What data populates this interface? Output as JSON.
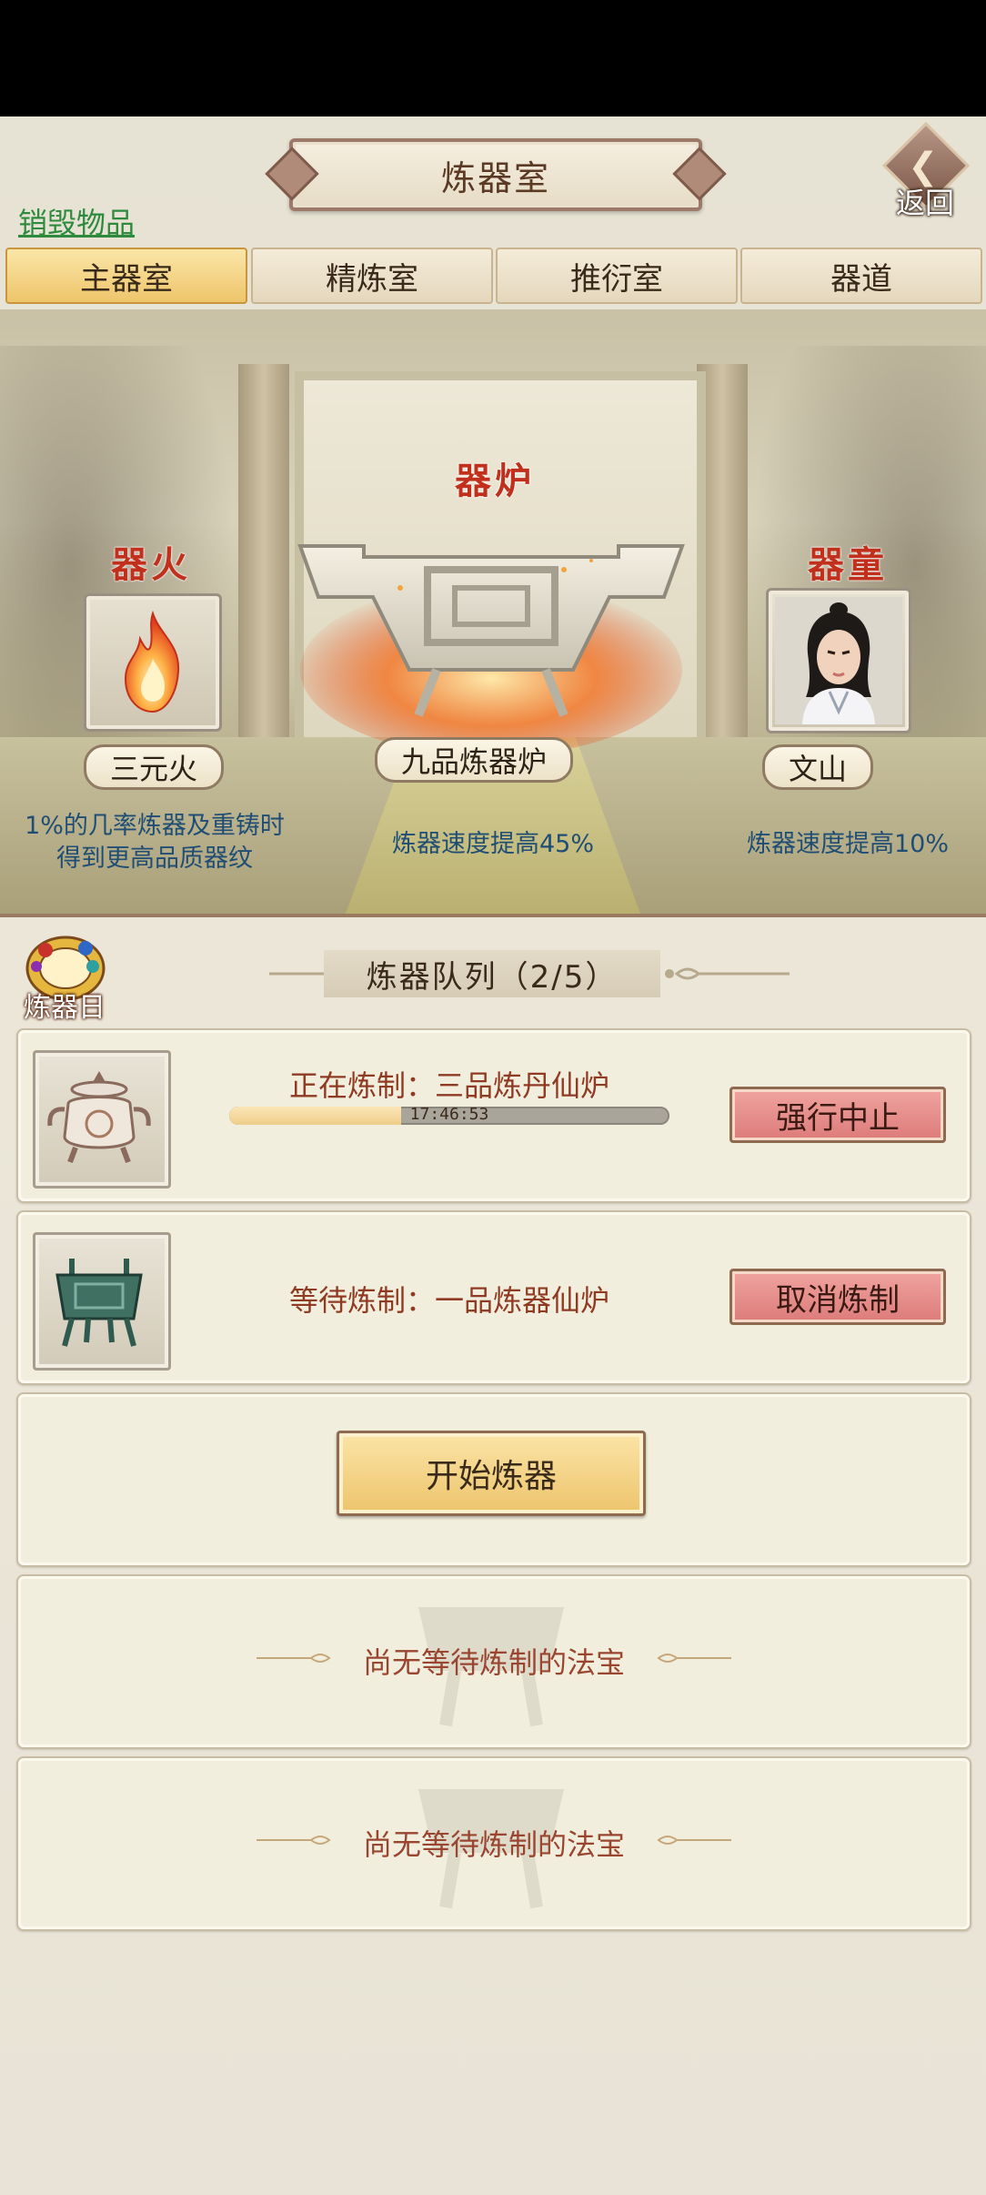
{
  "header": {
    "title": "炼器室",
    "back_label": "返回",
    "destroy_link": "销毁物品"
  },
  "tabs": [
    {
      "label": "主器室",
      "active": true
    },
    {
      "label": "精炼室",
      "active": false
    },
    {
      "label": "推衍室",
      "active": false
    },
    {
      "label": "器道",
      "active": false
    }
  ],
  "scene": {
    "fire": {
      "section_title": "器火",
      "name": "三元火",
      "desc_line1": "1%的几率炼器及重铸时",
      "desc_line2": "得到更高品质器纹",
      "icon": "flame-icon"
    },
    "furnace": {
      "section_title": "器炉",
      "name": "九品炼器炉",
      "desc": "炼器速度提高45%",
      "icon": "furnace-icon"
    },
    "servant": {
      "section_title": "器童",
      "name": "文山",
      "desc": "炼器速度提高10%",
      "icon": "portrait-icon"
    }
  },
  "queue": {
    "log_label": "炼器日志",
    "title": "炼器队列（2/5）",
    "items": [
      {
        "status": "正在炼制：三品炼丹仙炉",
        "time": "17:46:53",
        "progress": 0.39,
        "button": "强行中止",
        "icon": "white-incense-burner-icon"
      },
      {
        "status": "等待炼制：一品炼器仙炉",
        "button": "取消炼制",
        "icon": "bronze-cauldron-icon"
      }
    ],
    "start_button": "开始炼器",
    "empty_slots": [
      "尚无等待炼制的法宝",
      "尚无等待炼制的法宝"
    ]
  },
  "colors": {
    "accent_red": "#c0301d",
    "link_green": "#2e8b3e",
    "desc_blue": "#1f4d74",
    "button_red": "#dc7b7a",
    "button_gold": "#edc46c"
  }
}
